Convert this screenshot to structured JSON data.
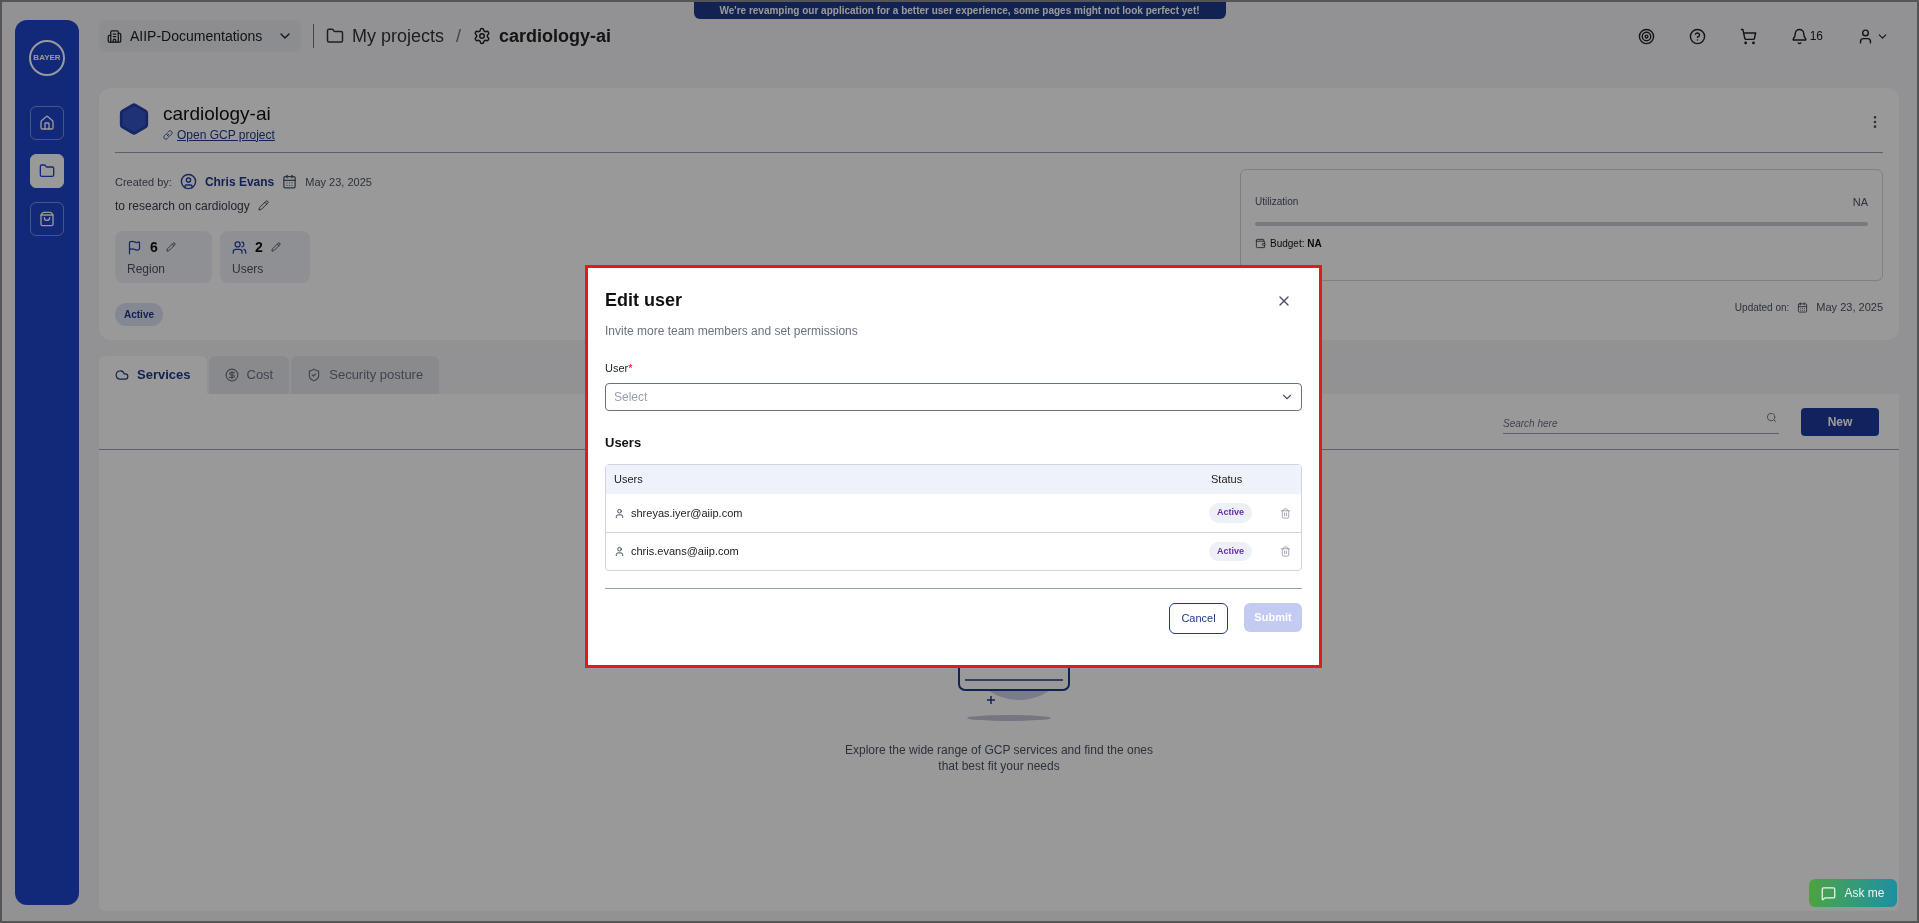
{
  "banner": "We're revamping our application for a better user experience, some pages might not look perfect yet!",
  "logo": "BAYER",
  "sidebar": {
    "items": [
      {
        "kind": "home",
        "selected": false
      },
      {
        "kind": "folder",
        "selected": true
      },
      {
        "kind": "bag",
        "selected": false
      }
    ]
  },
  "topbar": {
    "workspace": "AIIP-Documentations",
    "separator": "/",
    "breadcrumbs": [
      {
        "kind": "folder",
        "label": "My projects"
      },
      {
        "kind": "project",
        "label": "cardiology-ai"
      }
    ],
    "actions": [
      {
        "kind": "target"
      },
      {
        "kind": "help"
      },
      {
        "kind": "cart"
      },
      {
        "kind": "bell",
        "count": "16"
      },
      {
        "kind": "user"
      }
    ]
  },
  "project": {
    "name": "cardiology-ai",
    "link": "Open GCP project",
    "created_by_label": "Created by:",
    "creator": "Chris Evans",
    "created_date": "May 23, 2025",
    "description": "to research on cardiology",
    "stats": [
      {
        "kind": "flag",
        "value": "6",
        "label": "Region"
      },
      {
        "kind": "users",
        "value": "2",
        "label": "Users"
      }
    ],
    "status": "Active",
    "utilization": {
      "label": "Utilization",
      "value": "NA"
    },
    "budget": "Budget: **NA**",
    "updated_label": "Updated on:",
    "updated_date": "May 23, 2025"
  },
  "tabs": [
    {
      "kind": "cloud",
      "label": "Services",
      "selected": true
    },
    {
      "kind": "dollar",
      "label": "Cost",
      "selected": false
    },
    {
      "kind": "shield",
      "label": "Security posture",
      "selected": false
    }
  ],
  "search": {
    "placeholder": "Search here"
  },
  "new_button": "New",
  "empty_state": "Explore the wide range of GCP services and find the ones that best fit your needs",
  "modal": {
    "title": "Edit user",
    "subtitle": "Invite more team members and set permissions",
    "field_label": "User",
    "required_mark": "*",
    "placeholder": "Select",
    "section": "Users",
    "columns": [
      "Users",
      "Status"
    ],
    "rows": [
      {
        "email": "shreyas.iyer@aiip.com",
        "status": "Active"
      },
      {
        "email": "chris.evans@aiip.com",
        "status": "Active"
      }
    ],
    "cancel": "Cancel",
    "submit": {
      "label": "Submit",
      "disabled": true
    }
  },
  "ask_me": "Ask me"
}
